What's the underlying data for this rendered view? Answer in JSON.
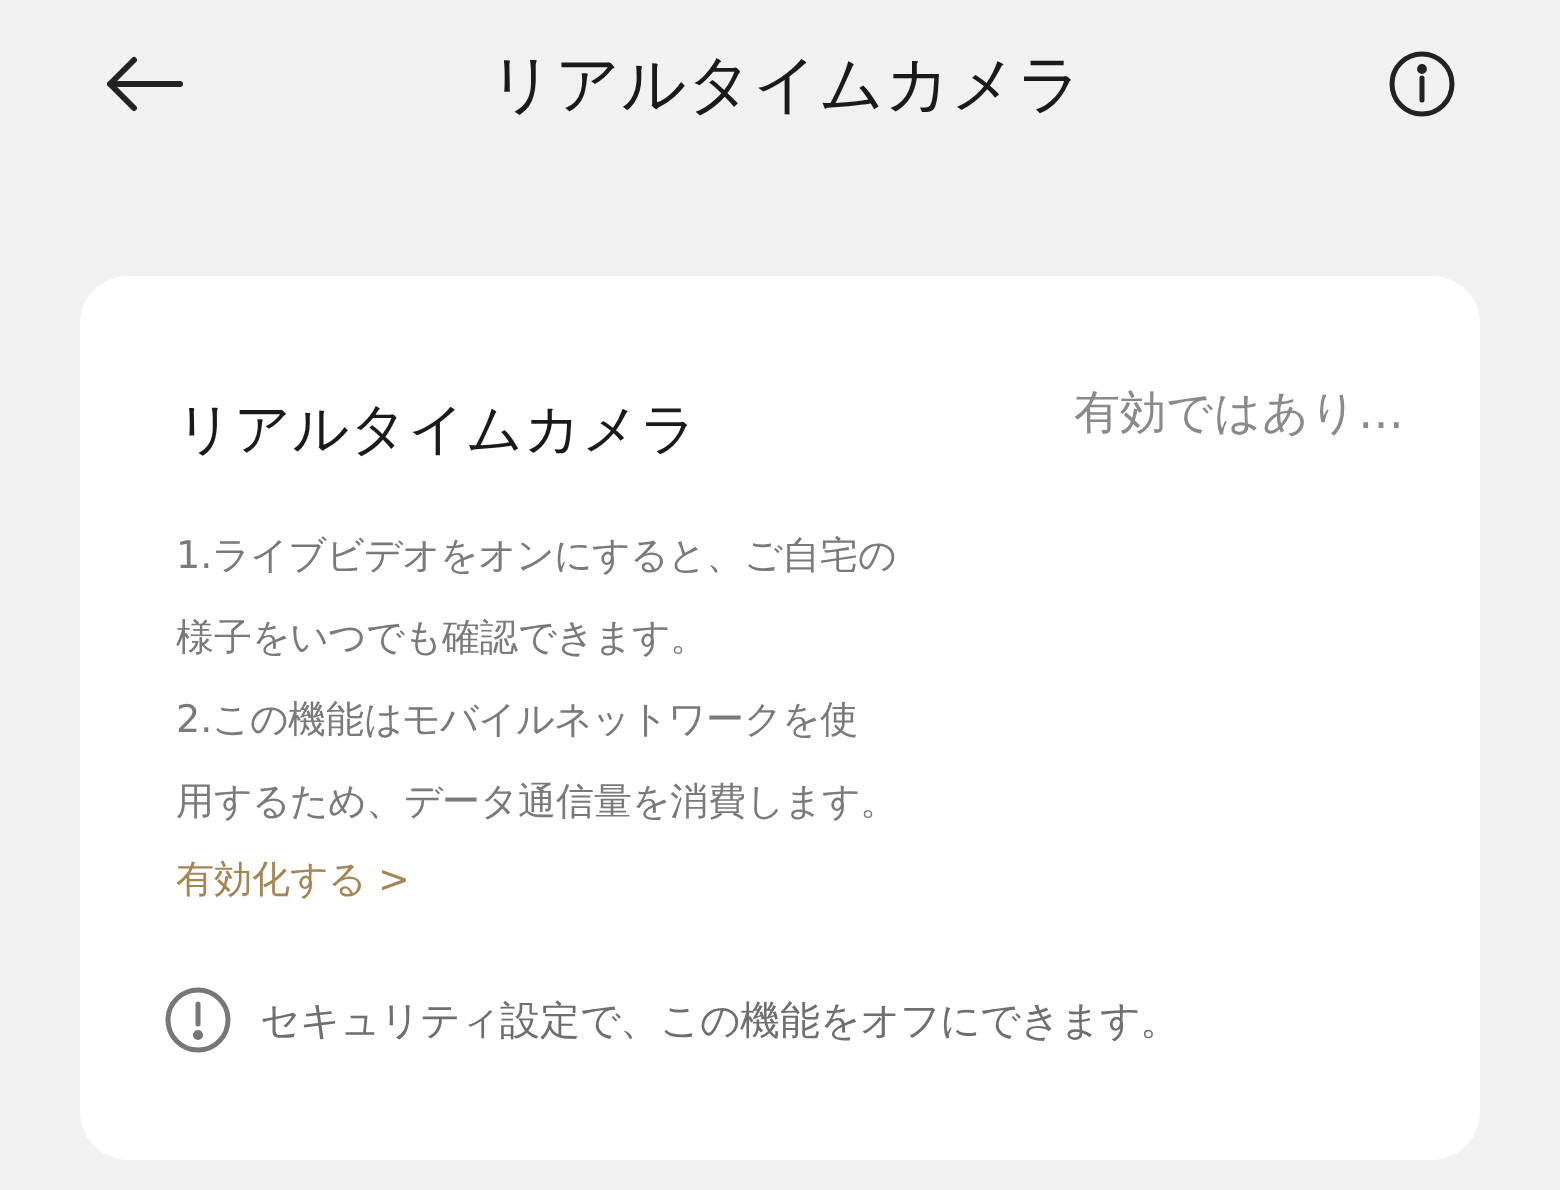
{
  "header": {
    "title": "リアルタイムカメラ"
  },
  "card": {
    "title": "リアルタイムカメラ",
    "status": "有効ではあり…",
    "description_lines": [
      "1.ライブビデオをオンにすると、ご自宅の",
      "様子をいつでも確認できます。",
      "2.この機能はモバイルネットワークを使",
      "用するため、データ通信量を消費します。"
    ],
    "link": "有効化する >",
    "note": "セキュリティ設定で、この機能をオフにできます。"
  }
}
